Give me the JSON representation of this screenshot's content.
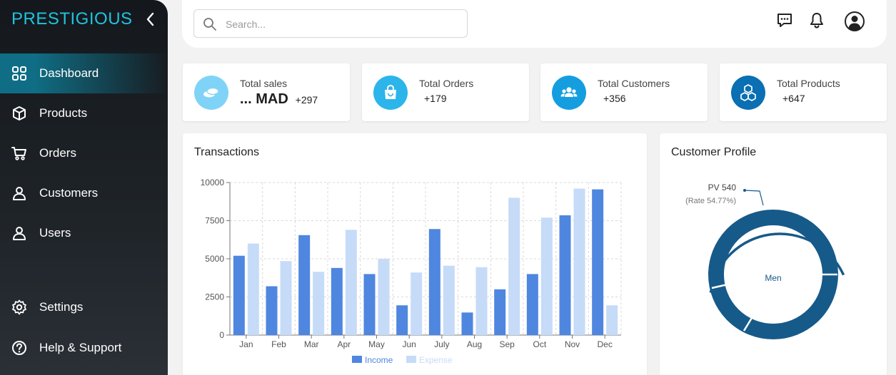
{
  "sidebar": {
    "brand": "PRESTIGIOUS",
    "items": [
      {
        "label": "Dashboard",
        "icon": "grid-icon"
      },
      {
        "label": "Products",
        "icon": "box-icon"
      },
      {
        "label": "Orders",
        "icon": "cart-icon"
      },
      {
        "label": "Customers",
        "icon": "customers-icon"
      },
      {
        "label": "Users",
        "icon": "users-icon"
      }
    ],
    "bottom": [
      {
        "label": "Settings",
        "icon": "gear-icon"
      },
      {
        "label": "Help & Support",
        "icon": "help-icon"
      }
    ]
  },
  "search": {
    "placeholder": "Search..."
  },
  "stats": [
    {
      "title": "Total sales",
      "value": "... MAD",
      "delta": "+297",
      "color": "#7fd3f7",
      "icon": "coins-icon"
    },
    {
      "title": "Total Orders",
      "delta": "+179",
      "color": "#2bb5ea",
      "icon": "bag-icon"
    },
    {
      "title": "Total Customers",
      "delta": "+356",
      "color": "#149ee0",
      "icon": "people-icon"
    },
    {
      "title": "Total Products",
      "delta": "+647",
      "color": "#0a6fb3",
      "icon": "cubes-icon"
    }
  ],
  "transactions": {
    "title": "Transactions"
  },
  "profile": {
    "title": "Customer Profile",
    "callout_main": "PV 540",
    "callout_sub": "(Rate 54.77%)",
    "center_label": "Men",
    "color": "#165a8a"
  },
  "chart_data": {
    "type": "bar",
    "categories": [
      "Jan",
      "Feb",
      "Mar",
      "Apr",
      "May",
      "Jun",
      "July",
      "Aug",
      "Sep",
      "Oct",
      "Nov",
      "Dec"
    ],
    "series": [
      {
        "name": "Income",
        "color": "#4f86e0",
        "values": [
          5200,
          3200,
          6550,
          4400,
          4000,
          1950,
          6950,
          1480,
          3000,
          4000,
          7850,
          9550
        ]
      },
      {
        "name": "Expense",
        "color": "#c6dbf7",
        "values": [
          6000,
          4850,
          4150,
          6900,
          5000,
          4100,
          4550,
          4450,
          9000,
          7700,
          9600,
          1950
        ]
      }
    ],
    "ylim": [
      0,
      10000
    ],
    "yticks": [
      "0",
      "2500",
      "5000",
      "7500",
      "10000"
    ],
    "grid": true,
    "legend": "bottom"
  }
}
